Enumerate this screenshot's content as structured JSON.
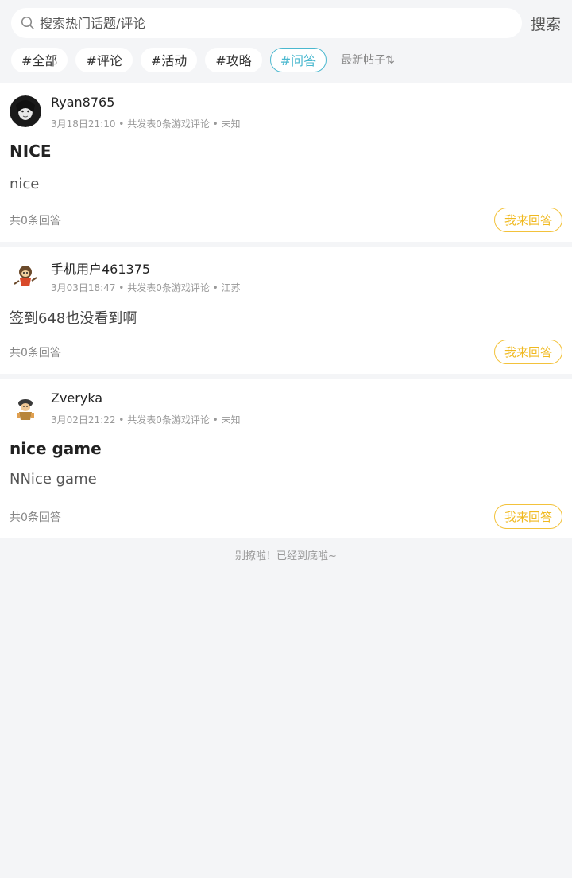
{
  "search": {
    "placeholder": "搜索热门话题/评论",
    "button_label": "搜索"
  },
  "tags": [
    {
      "label": "#全部",
      "active": false
    },
    {
      "label": "#评论",
      "active": false
    },
    {
      "label": "#活动",
      "active": false
    },
    {
      "label": "#攻略",
      "active": false
    },
    {
      "label": "#问答",
      "active": true
    }
  ],
  "sort_label": "最新帖子⇅",
  "posts": [
    {
      "username": "Ryan8765",
      "meta": "3月18日21:10 • 共发表0条游戏评论 • 未知",
      "title": "NICE",
      "body": "nice",
      "count": "共0条回答",
      "answer_label": "我来回答",
      "avatar": "dark-portrait-avatar"
    },
    {
      "username": "手机用户461375",
      "meta": "3月03日18:47 • 共发表0条游戏评论 • 江苏",
      "title": "",
      "body": "签到648也没看到啊",
      "count": "共0条回答",
      "answer_label": "我来回答",
      "avatar": "monkey-avatar"
    },
    {
      "username": "Zveryka",
      "meta": "3月02日21:22 • 共发表0条游戏评论 • 未知",
      "title": "nice game",
      "body": "NNice game",
      "count": "共0条回答",
      "answer_label": "我来回答",
      "avatar": "cartoon-warrior-avatar"
    }
  ],
  "end_text": "别撩啦！已经到底啦~",
  "colors": {
    "accent_teal": "#4bb8cf",
    "answer_gold": "#f0b91f",
    "background": "#f4f5f7"
  }
}
